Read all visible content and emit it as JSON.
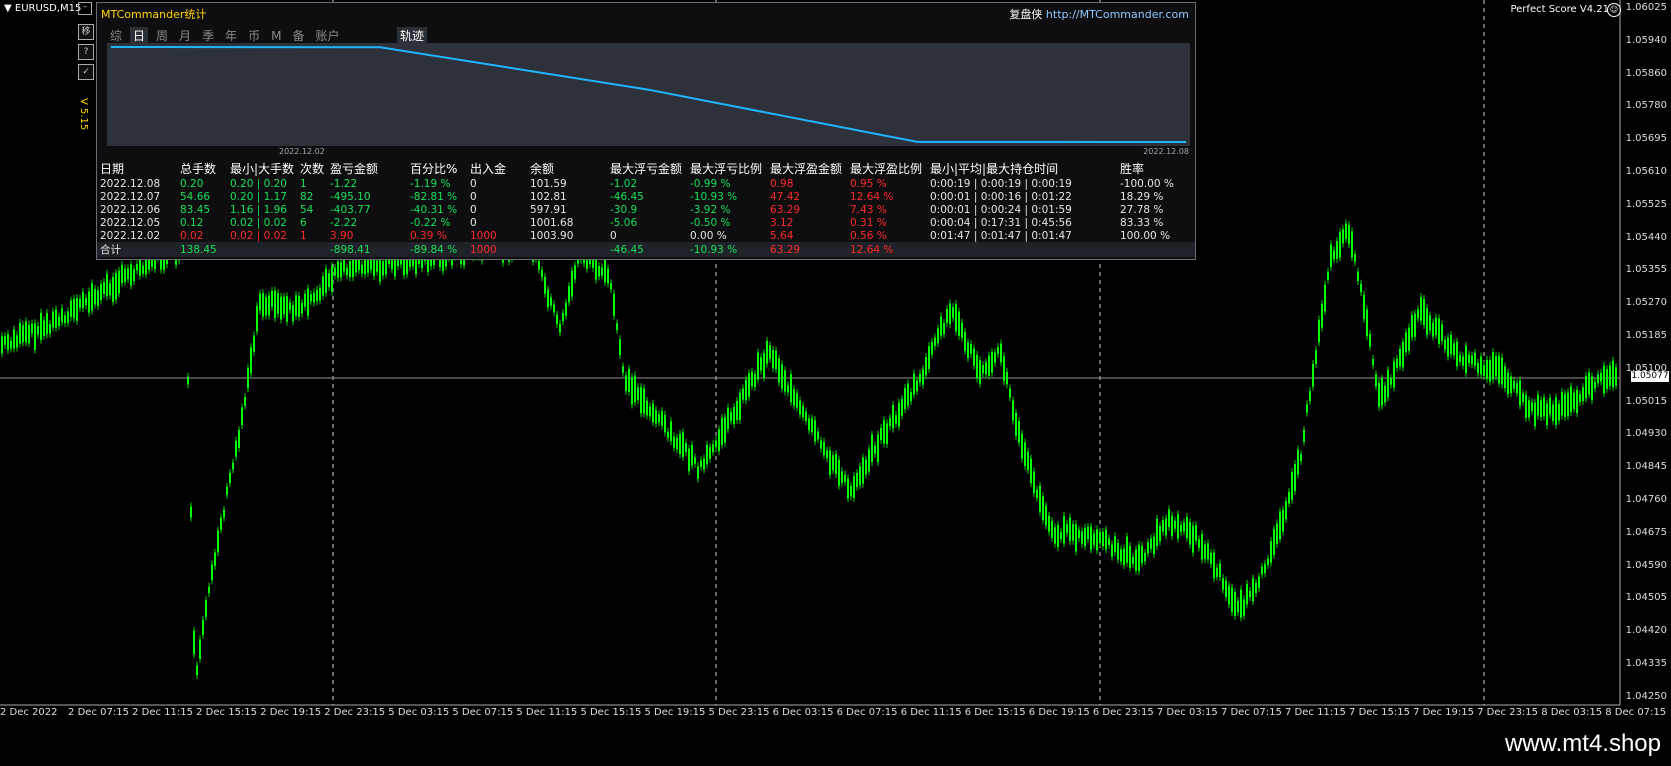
{
  "chart_window": {
    "symbol": "EURUSD,M15",
    "indicator": "Perfect Score V4.21",
    "current_price": "1.05077",
    "watermark": "www.mt4.shop",
    "colors": {
      "background": "#000000",
      "candle": "#00ff00",
      "grid": "#dddddd"
    },
    "price_labels": [
      "1.06025",
      "1.05940",
      "1.05860",
      "1.05780",
      "1.05695",
      "1.05610",
      "1.05525",
      "1.05440",
      "1.05355",
      "1.05270",
      "1.05185",
      "1.05100",
      "1.05015",
      "1.04930",
      "1.04845",
      "1.04760",
      "1.04675",
      "1.04590",
      "1.04505",
      "1.04420",
      "1.04335",
      "1.04250"
    ],
    "time_labels": [
      "2 Dec 2022",
      "2 Dec 07:15",
      "2 Dec 11:15",
      "2 Dec 15:15",
      "2 Dec 19:15",
      "2 Dec 23:15",
      "5 Dec 03:15",
      "5 Dec 07:15",
      "5 Dec 11:15",
      "5 Dec 15:15",
      "5 Dec 19:15",
      "5 Dec 23:15",
      "6 Dec 03:15",
      "6 Dec 07:15",
      "6 Dec 11:15",
      "6 Dec 15:15",
      "6 Dec 19:15",
      "6 Dec 23:15",
      "7 Dec 03:15",
      "7 Dec 07:15",
      "7 Dec 11:15",
      "7 Dec 15:15",
      "7 Dec 19:15",
      "7 Dec 23:15",
      "8 Dec 03:15",
      "8 Dec 07:15"
    ]
  },
  "side_buttons": [
    "移",
    "?",
    "✓"
  ],
  "version": "V 5.15",
  "panel": {
    "title": "MTCommander统计",
    "brand": "复盘侠",
    "url": "http://MTCommander.com",
    "tabs": [
      "综",
      "日",
      "周",
      "月",
      "季",
      "年",
      "币",
      "M",
      "备",
      "账户"
    ],
    "active_tab": "日",
    "trace_tab": "轨迹",
    "plot_start": "2022.12.02",
    "plot_end": "2022.12.08",
    "equity_curve": [
      1003.9,
      1001.68,
      597.91,
      102.81,
      101.59
    ],
    "headers": [
      "日期",
      "总手数",
      "最小|大手数",
      "次数",
      "盈亏金额",
      "百分比%",
      "出入金",
      "余额",
      "最大浮亏金额",
      "最大浮亏比例",
      "最大浮盈金额",
      "最大浮盈比例",
      "最小|平均|最大持仓时间",
      "胜率"
    ],
    "rows": [
      [
        "2022.12.08",
        "0.20",
        "0.20 | 0.20",
        "1",
        "-1.22",
        "-1.19 %",
        "0",
        "101.59",
        "-1.02",
        "-0.99 %",
        "0.98",
        "0.95 %",
        "0:00:19 | 0:00:19 | 0:00:19",
        "-100.00 %"
      ],
      [
        "2022.12.07",
        "54.66",
        "0.20 | 1.17",
        "82",
        "-495.10",
        "-82.81 %",
        "0",
        "102.81",
        "-46.45",
        "-10.93 %",
        "47.42",
        "12.64 %",
        "0:00:01 | 0:00:16 | 0:01:22",
        "18.29 %"
      ],
      [
        "2022.12.06",
        "83.45",
        "1.16 | 1.96",
        "54",
        "-403.77",
        "-40.31 %",
        "0",
        "597.91",
        "-30.9",
        "-3.92 %",
        "63.29",
        "7.43 %",
        "0:00:01 | 0:00:24 | 0:01:59",
        "27.78 %"
      ],
      [
        "2022.12.05",
        "0.12",
        "0.02 | 0.02",
        "6",
        "-2.22",
        "-0.22 %",
        "0",
        "1001.68",
        "-5.06",
        "-0.50 %",
        "3.12",
        "0.31 %",
        "0:00:04 | 0:17:31 | 0:45:56",
        "83.33 %"
      ],
      [
        "2022.12.02",
        "0.02",
        "0.02 | 0.02",
        "1",
        "3.90",
        "0.39 %",
        "1000",
        "1003.90",
        "0",
        "0.00 %",
        "5.64",
        "0.56 %",
        "0:01:47 | 0:01:47 | 0:01:47",
        "100.00 %"
      ]
    ],
    "row_colors": [
      [
        "w",
        "g",
        "g",
        "g",
        "g",
        "g",
        "w",
        "w",
        "g",
        "g",
        "r",
        "r",
        "w",
        "w"
      ],
      [
        "w",
        "g",
        "g",
        "g",
        "g",
        "g",
        "w",
        "w",
        "g",
        "g",
        "r",
        "r",
        "w",
        "w"
      ],
      [
        "w",
        "g",
        "g",
        "g",
        "g",
        "g",
        "w",
        "w",
        "g",
        "g",
        "r",
        "r",
        "w",
        "w"
      ],
      [
        "w",
        "g",
        "g",
        "g",
        "g",
        "g",
        "w",
        "w",
        "g",
        "g",
        "r",
        "r",
        "w",
        "w"
      ],
      [
        "w",
        "r",
        "r",
        "r",
        "r",
        "r",
        "r",
        "w",
        "w",
        "w",
        "r",
        "r",
        "w",
        "w"
      ]
    ],
    "total": [
      "合计",
      "138.45",
      "",
      "",
      "-898.41",
      "-89.84 %",
      "1000",
      "",
      "-46.45",
      "-10.93 %",
      "63.29",
      "12.64 %",
      "",
      ""
    ],
    "total_colors": [
      "w",
      "g",
      "w",
      "w",
      "g",
      "g",
      "r",
      "w",
      "g",
      "g",
      "r",
      "r",
      "w",
      "w"
    ]
  }
}
